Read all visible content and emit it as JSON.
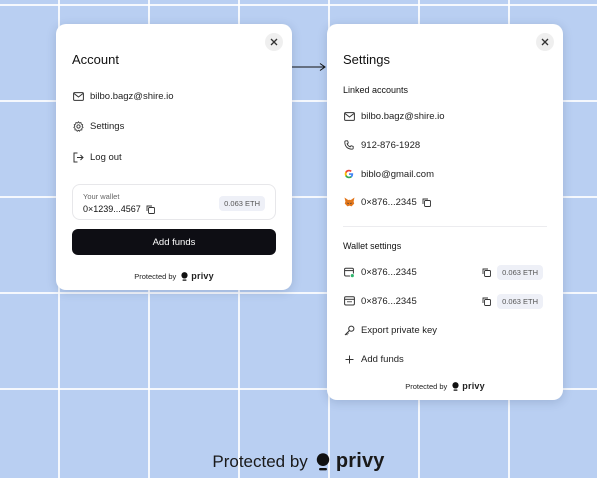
{
  "account": {
    "title": "Account",
    "email": "bilbo.bagz@shire.io",
    "settings_label": "Settings",
    "logout_label": "Log out",
    "wallet": {
      "label": "Your wallet",
      "address": "0×1239...4567",
      "balance": "0.063 ETH"
    },
    "add_funds_label": "Add funds",
    "protected_by": "Protected by",
    "brand": "privy"
  },
  "settings": {
    "title": "Settings",
    "linked_accounts_label": "Linked accounts",
    "linked_accounts": [
      {
        "icon": "mail-icon",
        "value": "bilbo.bagz@shire.io"
      },
      {
        "icon": "phone-icon",
        "value": "912-876-1928"
      },
      {
        "icon": "google-icon",
        "value": "biblo@gmail.com"
      },
      {
        "icon": "metamask-icon",
        "value": "0×876...2345"
      }
    ],
    "wallet_settings_label": "Wallet settings",
    "wallets": [
      {
        "address": "0×876...2345",
        "balance": "0.063 ETH"
      },
      {
        "address": "0×876...2345",
        "balance": "0.063 ETH"
      }
    ],
    "export_label": "Export private key",
    "add_funds_label": "Add funds",
    "protected_by": "Protected by",
    "brand": "privy"
  },
  "footer": {
    "protected_by": "Protected by",
    "brand": "privy"
  },
  "colors": {
    "background": "#b9cff2",
    "primary_button": "#0e0e14",
    "badge_bg": "#eef0f7",
    "metamask": "#e2761b",
    "wallet_active_dot": "#2fb36b"
  }
}
